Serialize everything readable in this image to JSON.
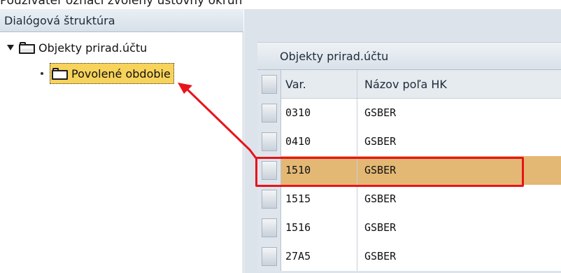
{
  "caption": "Používateľ označí zvolený ústovný okruh",
  "tree": {
    "header": "Dialógová štruktúra",
    "root_label": "Objekty prirad.účtu",
    "child_label": "Povolené obdobie"
  },
  "table": {
    "title": "Objekty prirad.účtu",
    "columns": [
      "Var.",
      "Názov poľa HK"
    ],
    "rows": [
      {
        "var": "0310",
        "name": "GSBER"
      },
      {
        "var": "0410",
        "name": "GSBER"
      },
      {
        "var": "1510",
        "name": "GSBER"
      },
      {
        "var": "1515",
        "name": "GSBER"
      },
      {
        "var": "1516",
        "name": "GSBER"
      },
      {
        "var": "27A5",
        "name": "GSBER"
      }
    ],
    "selected_index": 2
  },
  "colors": {
    "highlight": "#e8131b",
    "selected_row": "#e3b874",
    "selected_node": "#f8d35b"
  },
  "icons": [
    "triangle-down-icon",
    "folder-open-icon",
    "folder-icon",
    "bullet-icon"
  ]
}
